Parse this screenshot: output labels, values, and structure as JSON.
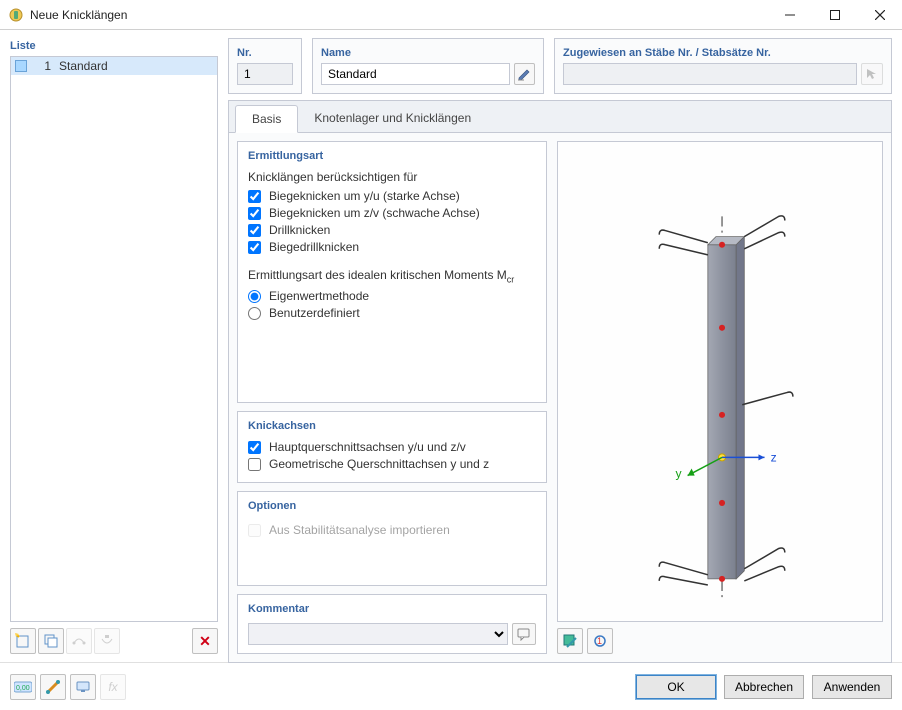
{
  "window": {
    "title": "Neue Knicklängen"
  },
  "list": {
    "header": "Liste",
    "items": [
      {
        "num": "1",
        "name": "Standard"
      }
    ]
  },
  "fields": {
    "nr_label": "Nr.",
    "nr_value": "1",
    "name_label": "Name",
    "name_value": "Standard",
    "assign_label": "Zugewiesen an Stäbe Nr. / Stabsätze Nr.",
    "assign_value": ""
  },
  "tabs": {
    "basis": "Basis",
    "knoten": "Knotenlager und Knicklängen"
  },
  "panels": {
    "ermittlungsart": {
      "title": "Ermittlungsart",
      "consider_label": "Knicklängen berücksichtigen für",
      "chk1": "Biegeknicken um y/u (starke Achse)",
      "chk2": "Biegeknicken um z/v (schwache Achse)",
      "chk3": "Drillknicken",
      "chk4": "Biegedrillknicken",
      "mcr_label": "Ermittlungsart des idealen kritischen Moments M",
      "mcr_sub": "cr",
      "rad1": "Eigenwertmethode",
      "rad2": "Benutzerdefiniert"
    },
    "knickachsen": {
      "title": "Knickachsen",
      "chk1": "Hauptquerschnittsachsen y/u und z/v",
      "chk2": "Geometrische Querschnittachsen y und z"
    },
    "optionen": {
      "title": "Optionen",
      "chk1": "Aus Stabilitätsanalyse importieren"
    },
    "kommentar": {
      "title": "Kommentar"
    }
  },
  "preview": {
    "axis_y": "y",
    "axis_z": "z"
  },
  "buttons": {
    "ok": "OK",
    "cancel": "Abbrechen",
    "apply": "Anwenden"
  }
}
